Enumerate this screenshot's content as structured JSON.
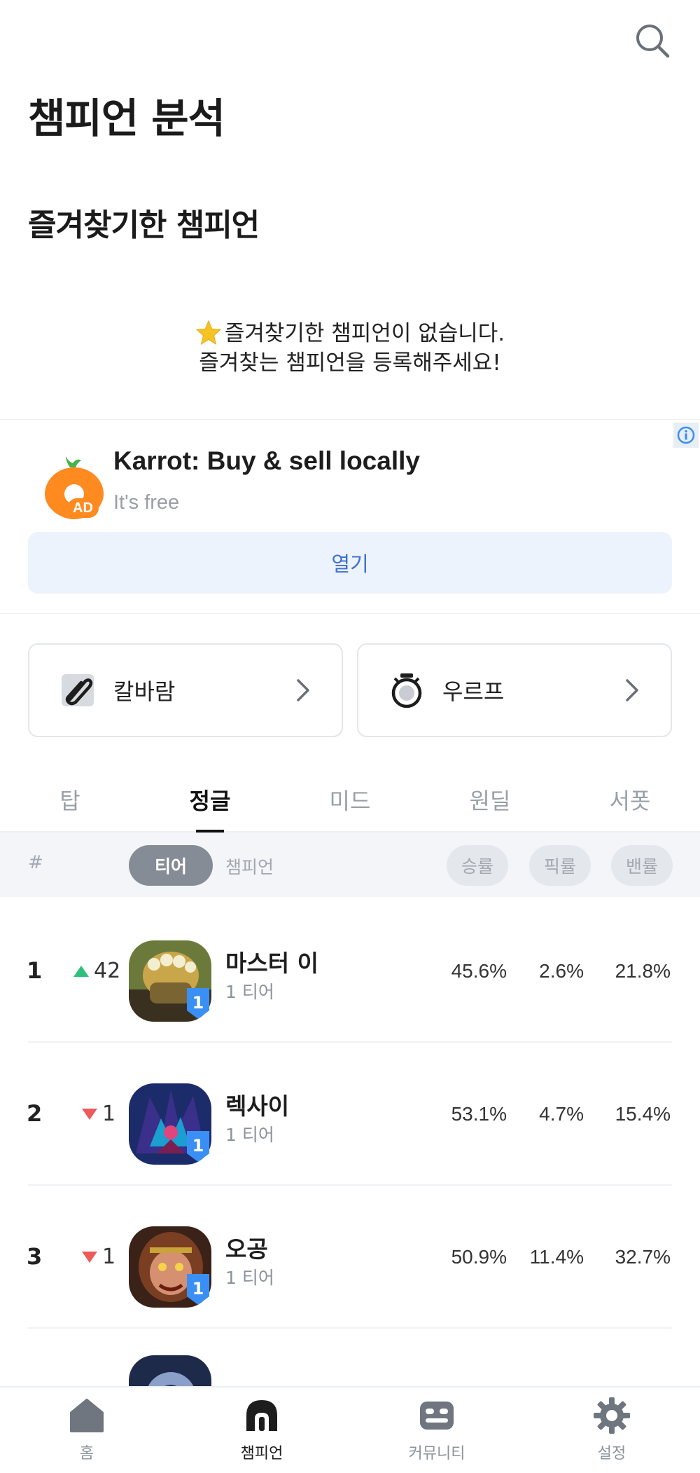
{
  "header": {
    "title": "챔피언 분석",
    "search_icon": "search-icon"
  },
  "favorites": {
    "title": "즐겨찾기한 챔피언",
    "empty_line1": "즐겨찾기한 챔피언이 없습니다.",
    "empty_line2": "즐겨찾는 챔피언을 등록해주세요!"
  },
  "ad": {
    "headline": "Karrot: Buy & sell locally",
    "subtitle": "It's free",
    "badge": "AD",
    "open_label": "열기",
    "brand_color": "#ff8a1f"
  },
  "modes": [
    {
      "label": "칼바람",
      "icon": "aram-icon"
    },
    {
      "label": "우르프",
      "icon": "urf-icon"
    }
  ],
  "tabs": [
    {
      "label": "탑"
    },
    {
      "label": "정글",
      "active": true
    },
    {
      "label": "미드"
    },
    {
      "label": "원딜"
    },
    {
      "label": "서폿"
    }
  ],
  "table_header": {
    "rank": "#",
    "tier": "티어",
    "champion": "챔피언",
    "winrate": "승률",
    "pickrate": "픽률",
    "banrate": "밴률"
  },
  "rows": [
    {
      "rank": "1",
      "trend": "up",
      "delta": "42",
      "name": "마스터 이",
      "tier": "1 티어",
      "badge": "1",
      "winrate": "45.6%",
      "pickrate": "2.6%",
      "banrate": "21.8%"
    },
    {
      "rank": "2",
      "trend": "down",
      "delta": "1",
      "name": "렉사이",
      "tier": "1 티어",
      "badge": "1",
      "winrate": "53.1%",
      "pickrate": "4.7%",
      "banrate": "15.4%"
    },
    {
      "rank": "3",
      "trend": "down",
      "delta": "1",
      "name": "오공",
      "tier": "1 티어",
      "badge": "1",
      "winrate": "50.9%",
      "pickrate": "11.4%",
      "banrate": "32.7%"
    }
  ],
  "nav": [
    {
      "label": "홈",
      "icon": "home-icon"
    },
    {
      "label": "챔피언",
      "icon": "champion-icon",
      "active": true
    },
    {
      "label": "커뮤니티",
      "icon": "community-icon"
    },
    {
      "label": "설정",
      "icon": "settings-icon"
    }
  ],
  "colors": {
    "up": "#2fc17b",
    "down": "#ec5a5a",
    "tier_badge": "#3a8ff5",
    "accent_link": "#3d6fd1"
  }
}
